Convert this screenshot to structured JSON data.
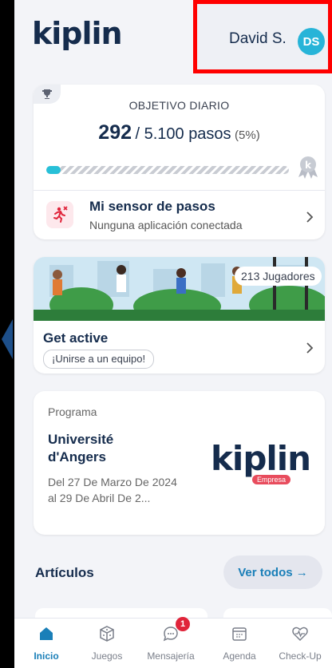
{
  "header": {
    "logo": "kiplin",
    "user_name": "David S.",
    "avatar_initials": "DS"
  },
  "daily_goal": {
    "title": "OBJETIVO DIARIO",
    "value": "292",
    "target": "/ 5.100 pasos",
    "percent_label": "(5%)",
    "progress_fraction": 0.05
  },
  "sensor": {
    "title": "Mi sensor de pasos",
    "subtitle": "Nunguna aplicación conectada"
  },
  "get_active": {
    "players": "213 Jugadores",
    "title": "Get active",
    "join_label": "¡Unirse a un equipo!"
  },
  "program": {
    "label": "Programa",
    "name": "Université d'Angers",
    "dates": "Del 27 De Marzo De 2024 al 29 De Abril De 2...",
    "logo_text": "kiplin",
    "logo_tag": "Empresa"
  },
  "articles": {
    "title": "Artículos",
    "see_all": "Ver todos →"
  },
  "tabs": [
    {
      "label": "Inicio",
      "icon": "home-icon",
      "active": true
    },
    {
      "label": "Juegos",
      "icon": "dice-icon"
    },
    {
      "label": "Mensajería",
      "icon": "chat-icon",
      "badge": "1"
    },
    {
      "label": "Agenda",
      "icon": "calendar-icon"
    },
    {
      "label": "Check-Up",
      "icon": "heart-pulse-icon"
    }
  ],
  "colors": {
    "accent": "#27c0d8",
    "brand_dark": "#152c4d",
    "link": "#1a7fb8",
    "highlight_border": "#ff0000"
  }
}
